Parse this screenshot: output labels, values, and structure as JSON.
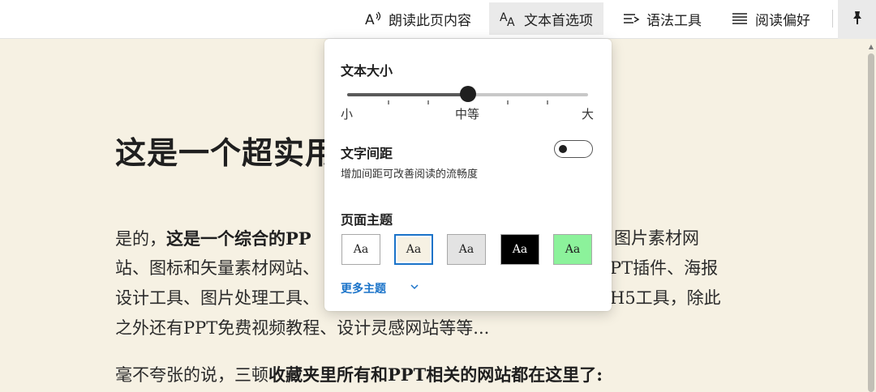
{
  "toolbar": {
    "read_aloud": "朗读此页内容",
    "text_prefs": "文本首选项",
    "grammar": "语法工具",
    "reading_prefs": "阅读偏好"
  },
  "article": {
    "title": "这是一个超实用",
    "p1_a": "是的，",
    "p1_b": "这是一个综合的PP",
    "p1_c": "图片素材网",
    "p1_d": "站、图标和矢量素材网站、",
    "p1_e": "PT插件、海报",
    "p1_f": "设计工具、图片处理工具、",
    "p1_g": "H5工具，除此",
    "p1_h": "之外还有PPT免费视频教程、设计灵感网站等等...",
    "p2_a": "毫不夸张的说，三顿",
    "p2_b": "收藏夹里所有和PPT相关的网站都在这里了:"
  },
  "panel": {
    "text_size_title": "文本大小",
    "text_size_value": 0.5,
    "size_min": "小",
    "size_mid": "中等",
    "size_max": "大",
    "spacing_title": "文字间距",
    "spacing_desc": "增加间距可改善阅读的流畅度",
    "spacing_on": false,
    "theme_title": "页面主题",
    "themes": [
      {
        "label": "Aa",
        "bg": "#ffffff",
        "fg": "#1f1f1f"
      },
      {
        "label": "Aa",
        "bg": "#f6f1e3",
        "fg": "#1f1f1f"
      },
      {
        "label": "Aa",
        "bg": "#e3e3e3",
        "fg": "#1f1f1f"
      },
      {
        "label": "Aa",
        "bg": "#000000",
        "fg": "#ffffff"
      },
      {
        "label": "Aa",
        "bg": "#8cf29b",
        "fg": "#1f1f1f"
      }
    ],
    "selected_theme": 1,
    "more_themes": "更多主题"
  },
  "colors": {
    "accent": "#1a73c9",
    "page_bg": "#f6f1e3"
  }
}
